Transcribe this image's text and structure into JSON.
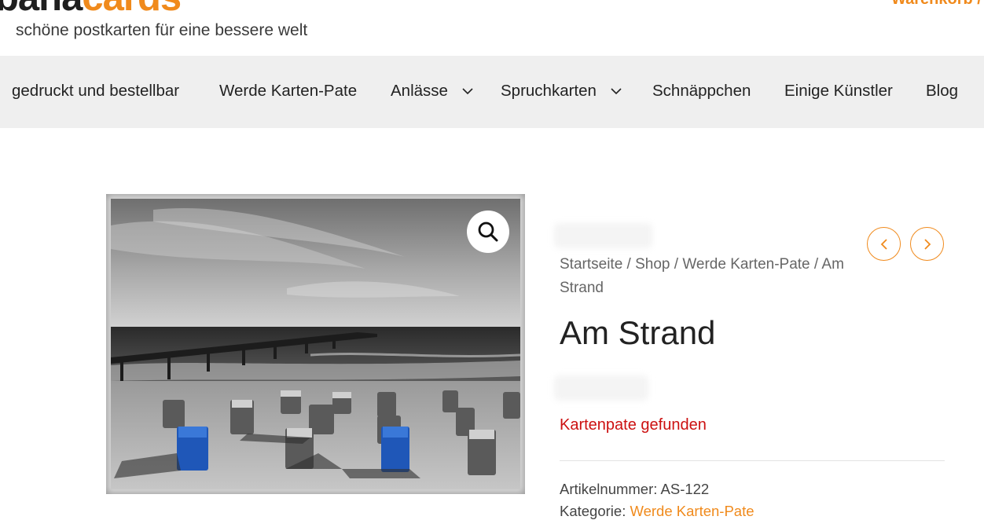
{
  "header": {
    "logo_part1": "bana",
    "logo_part2": "cards",
    "tagline": "schöne postkarten für eine bessere welt",
    "cart_label": "Warenkorb /"
  },
  "nav": {
    "items": [
      {
        "label": "gedruckt und bestellbar"
      },
      {
        "label": "Werde Karten-Pate"
      },
      {
        "label": "Anlässe",
        "has_dropdown": true
      },
      {
        "label": "Spruchkarten",
        "has_dropdown": true
      },
      {
        "label": "Schnäppchen"
      },
      {
        "label": "Einige Künstler"
      },
      {
        "label": "Blog"
      }
    ]
  },
  "product": {
    "breadcrumb": [
      "Startseite",
      "Shop",
      "Werde Karten-Pate",
      "Am Strand"
    ],
    "breadcrumb_separator": " / ",
    "title": "Am Strand",
    "stock_status": "Kartenpate gefunden",
    "sku_label": "Artikelnummer:",
    "sku_value": "AS-122",
    "category_label": "Kategorie:",
    "category_value": "Werde Karten-Pate",
    "image_alt": "Am Strand"
  },
  "icons": {
    "zoom": "search-icon",
    "prev": "chevron-left-icon",
    "next": "chevron-right-icon",
    "dropdown": "chevron-down-icon"
  },
  "colors": {
    "accent": "#f08a1c",
    "nav_bg": "#efefef",
    "stock_status": "#cc1111",
    "text": "#222222"
  }
}
